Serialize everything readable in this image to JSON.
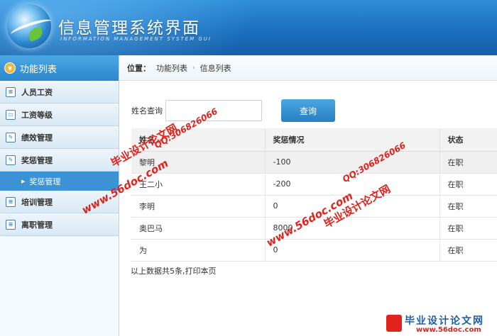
{
  "header": {
    "title": "信息管理系统界面",
    "subtitle": "INFORMATION MANAGEMENT SYSTEM GUI"
  },
  "sidebar": {
    "title": "功能列表",
    "items": [
      {
        "label": "人员工资"
      },
      {
        "label": "工资等级"
      },
      {
        "label": "绩效管理"
      },
      {
        "label": "奖惩管理"
      },
      {
        "label": "奖惩管理"
      },
      {
        "label": "培训管理"
      },
      {
        "label": "离职管理"
      }
    ]
  },
  "breadcrumb": {
    "label": "位置：",
    "items": [
      "功能列表",
      "信息列表"
    ]
  },
  "search": {
    "label": "姓名查询",
    "value": "",
    "button": "查询"
  },
  "table": {
    "headers": [
      "姓名",
      "奖惩情况",
      "状态"
    ],
    "rows": [
      [
        "黎明",
        "-100",
        "在职"
      ],
      [
        "王二小",
        "-200",
        "在职"
      ],
      [
        "李明",
        "0",
        "在职"
      ],
      [
        "奥巴马",
        "8000",
        "在职"
      ],
      [
        "为",
        "0",
        "在职"
      ]
    ]
  },
  "footer": "以上数据共5条,打印本页",
  "watermarks": {
    "cn": "毕业设计论文网",
    "url": "www.56doc.com",
    "qq": "QQ:306826066"
  },
  "badge": {
    "cn": "毕业设计论文网",
    "url": "www.56doc.com"
  }
}
